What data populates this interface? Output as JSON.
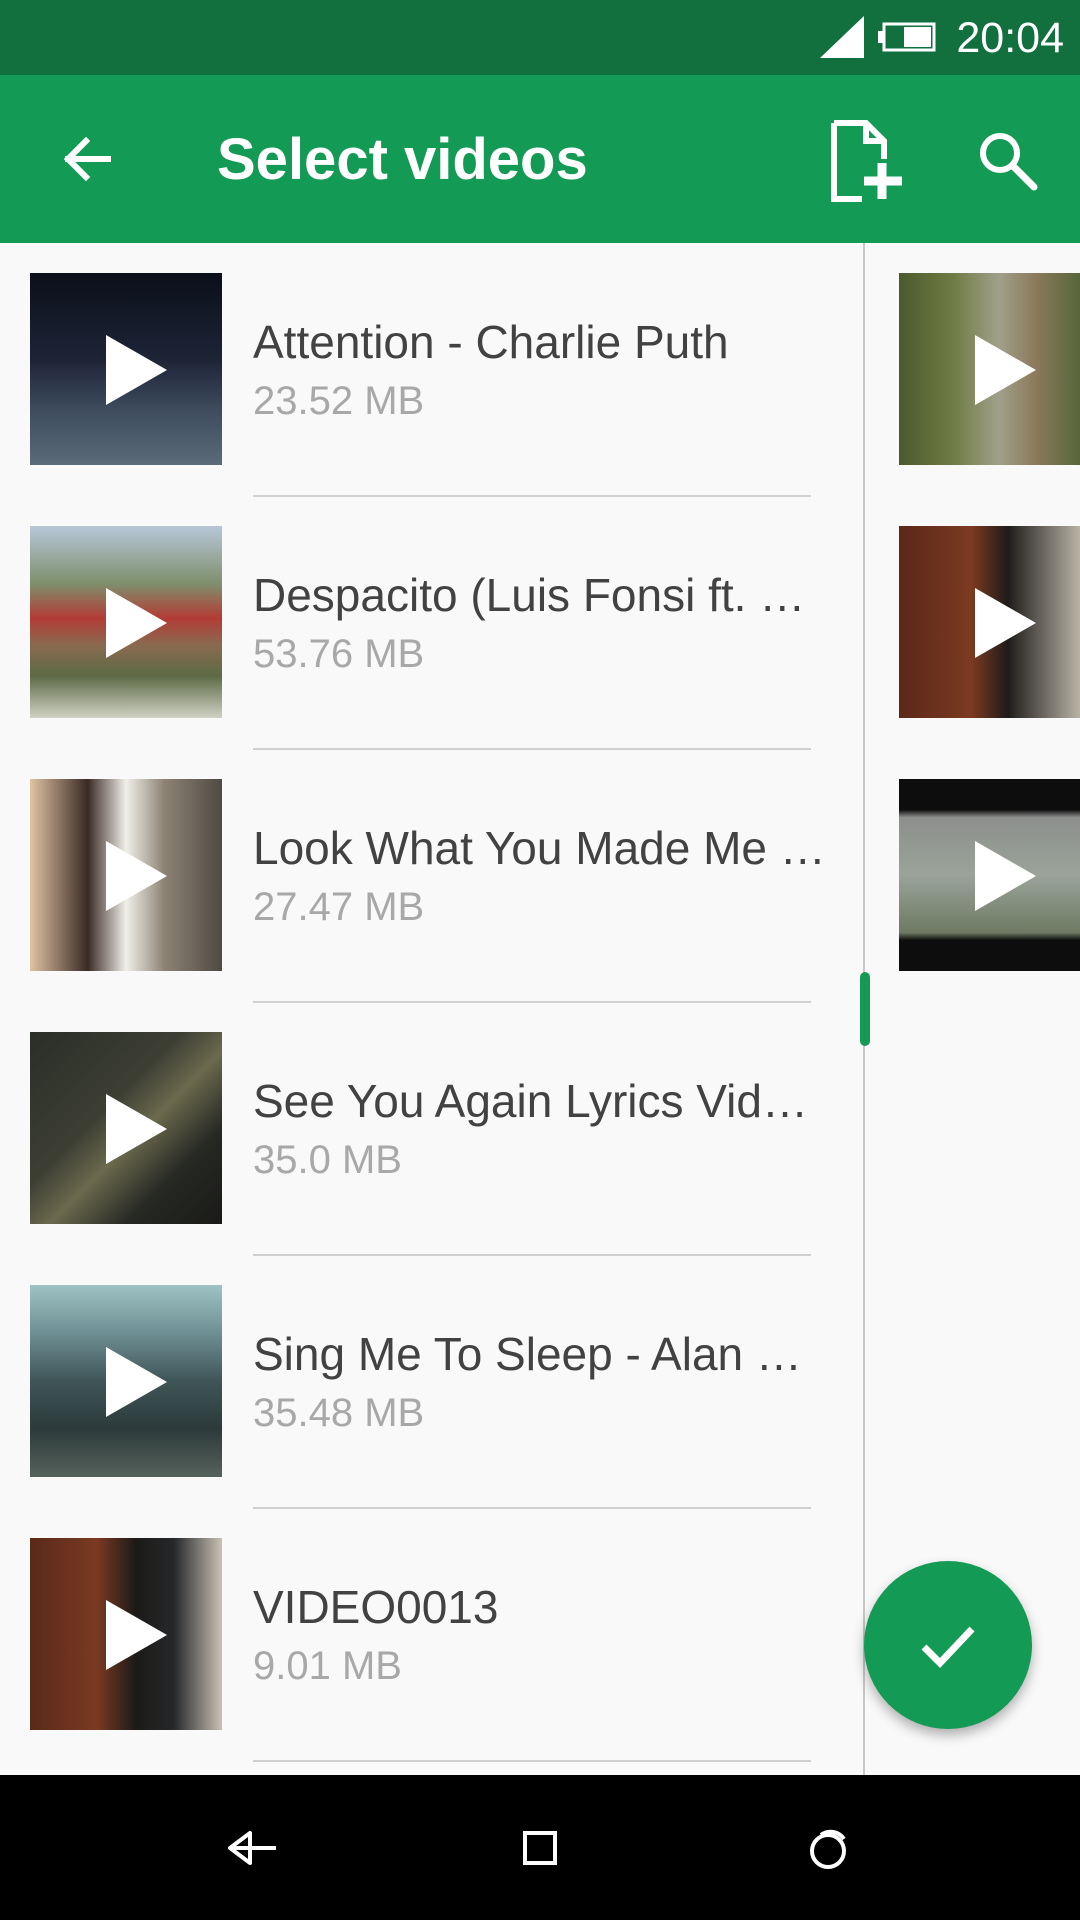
{
  "status_bar": {
    "time": "20:04"
  },
  "app_bar": {
    "title": "Select videos",
    "icons": [
      "arrow-back-icon",
      "add-file-icon",
      "search-icon"
    ]
  },
  "videos": [
    {
      "name": "Attention - Charlie Puth",
      "size": "23.52 MB"
    },
    {
      "name": "Despacito (Luis Fonsi ft. …",
      "size": "53.76 MB"
    },
    {
      "name": "Look What You Made Me …",
      "size": "27.47 MB"
    },
    {
      "name": "See You Again Lyrics Vid…",
      "size": "35.0 MB"
    },
    {
      "name": "Sing Me To Sleep - Alan …",
      "size": "35.48 MB"
    },
    {
      "name": "VIDEO0013",
      "size": "9.01 MB"
    }
  ],
  "fab": {
    "icon": "check-icon"
  },
  "nav_bar": {
    "icons": [
      "nav-back-icon",
      "nav-home-icon",
      "nav-recents-icon"
    ]
  },
  "colors": {
    "status_bar": "#12703f",
    "app_bar": "#139a55",
    "accent": "#139a55"
  }
}
